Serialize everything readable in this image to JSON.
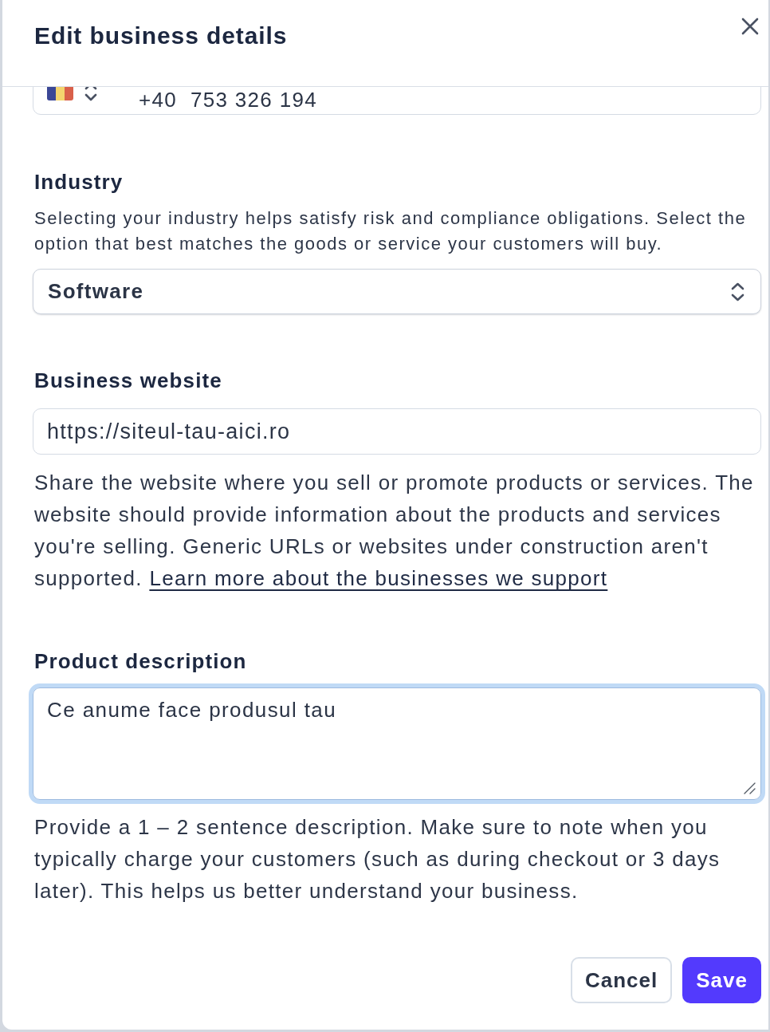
{
  "dialog": {
    "title": "Edit business details"
  },
  "phone_field": {
    "value": "+40  753 326 194"
  },
  "industry": {
    "label": "Industry",
    "description": "Selecting your industry helps satisfy risk and compliance obligations. Select the option that best matches the goods or service your customers will buy.",
    "value": "Software"
  },
  "business_website": {
    "label": "Business website",
    "value": "https://siteul-tau-aici.ro",
    "help": "Share the website where you sell or promote products or services. The website should provide information about the products and services you're selling. Generic URLs or websites under construction aren't supported.",
    "link": "Learn more about the businesses we support"
  },
  "product_description": {
    "label": "Product description",
    "value": "Ce anume face produsul tau",
    "focused": true,
    "help": "Provide a 1 – 2 sentence description. Make sure to note when you typically charge your customers (such as during checkout or 3 days later). This helps us better understand your business."
  },
  "buttons": [
    {
      "label": "Cancel",
      "kind": "secondary"
    },
    {
      "label": "Save",
      "kind": "primary"
    }
  ]
}
